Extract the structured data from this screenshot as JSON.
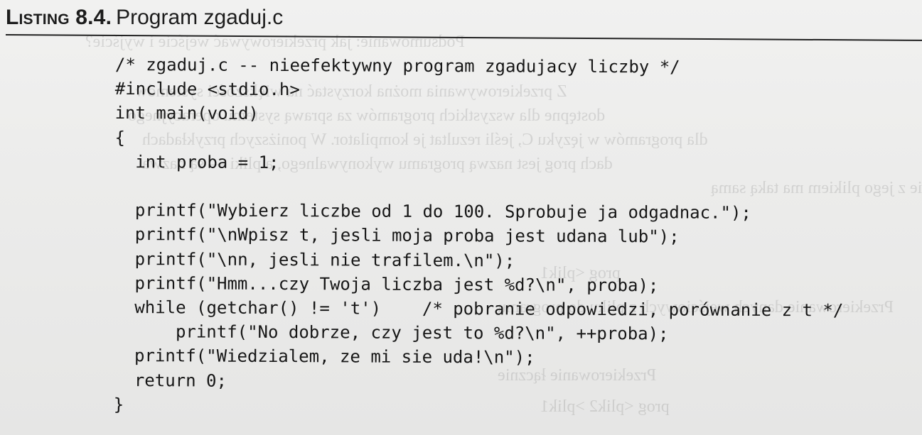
{
  "listing": {
    "label": "Listing 8.4.",
    "title": "Program zgaduj.c"
  },
  "code_lines": [
    "/* zgaduj.c -- nieefektywny program zgadujacy liczby */",
    "#include <stdio.h>",
    "int main(void)",
    "{",
    "  int proba = 1;",
    "",
    "  printf(\"Wybierz liczbe od 1 do 100. Sprobuje ja odgadnac.\");",
    "  printf(\"\\nWpisz t, jesli moja proba jest udana lub\");",
    "  printf(\"\\nn, jesli nie trafilem.\\n\");",
    "  printf(\"Hmm...czy Twoja liczba jest %d?\\n\", proba);",
    "  while (getchar() != 't')    /* pobranie odpowiedzi, porównanie z t */",
    "      printf(\"No dobrze, czy jest to %d?\\n\", ++proba);",
    "  printf(\"Wiedzialem, ze mi sie uda!\\n\");",
    "  return 0;",
    "}"
  ],
  "colors": {
    "text": "#161616",
    "paper": "#ececeb"
  }
}
